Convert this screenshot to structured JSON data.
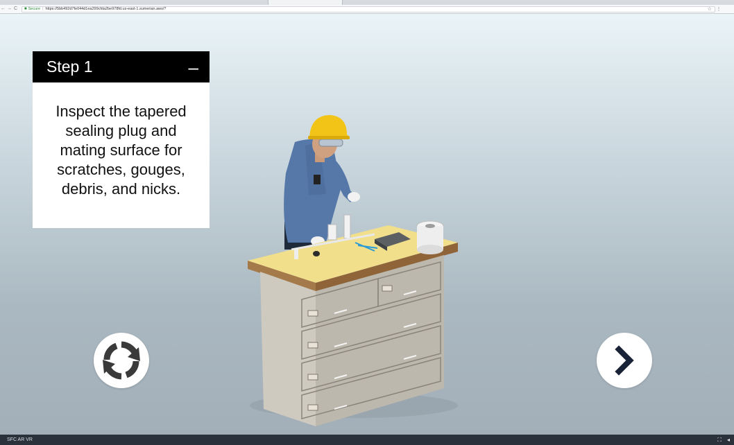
{
  "browser": {
    "back_glyph": "←",
    "forward_glyph": "→",
    "reload_glyph": "C",
    "secure_label": "Secure",
    "url": "https://5bb492d7fe044d1ea299cfda2be978fd.us-east-1.sumerian.aws/?",
    "star_glyph": "☆",
    "menu_glyph": "⋮"
  },
  "step": {
    "title": "Step 1",
    "collapse_label": "–",
    "instruction": "Inspect the tapered sealing plug and mating surface for scratches, gouges, debris, and nicks."
  },
  "controls": {
    "restart_icon": "restart-icon",
    "next_icon": "chevron-right-icon"
  },
  "footer": {
    "app_label": "SFC AR VR",
    "fullscreen_glyph": "⛶",
    "settings_glyph": "◂"
  },
  "colors": {
    "panel_header": "#000000",
    "next_chevron": "#1a2238",
    "restart_icon": "#3a3a3a",
    "footer_bg": "#2a313a"
  }
}
